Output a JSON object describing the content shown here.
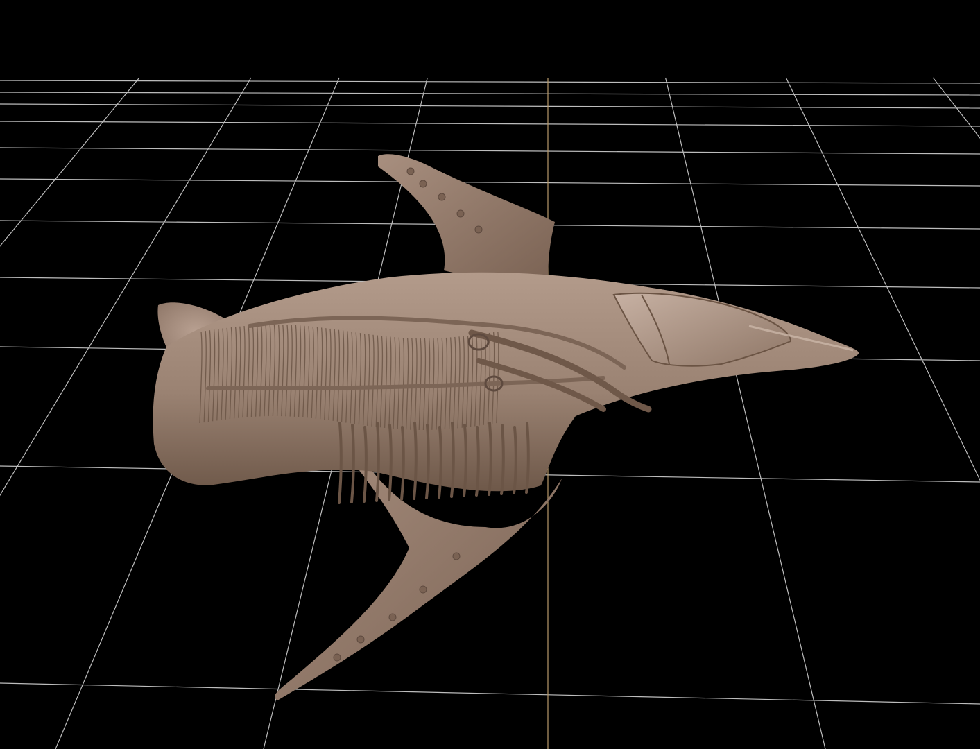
{
  "app": {
    "view": "3d-viewport",
    "background_color": "#000000"
  },
  "viewport": {
    "grid": {
      "visible": true,
      "line_color": "#bdbdbd",
      "axis_color": "#b89a6a"
    },
    "model": {
      "icon": "alien-spaceship-sculpt",
      "material_color": "#9e8676",
      "highlight_color": "#c2ab9c",
      "shadow_color": "#5e4a3f"
    }
  }
}
